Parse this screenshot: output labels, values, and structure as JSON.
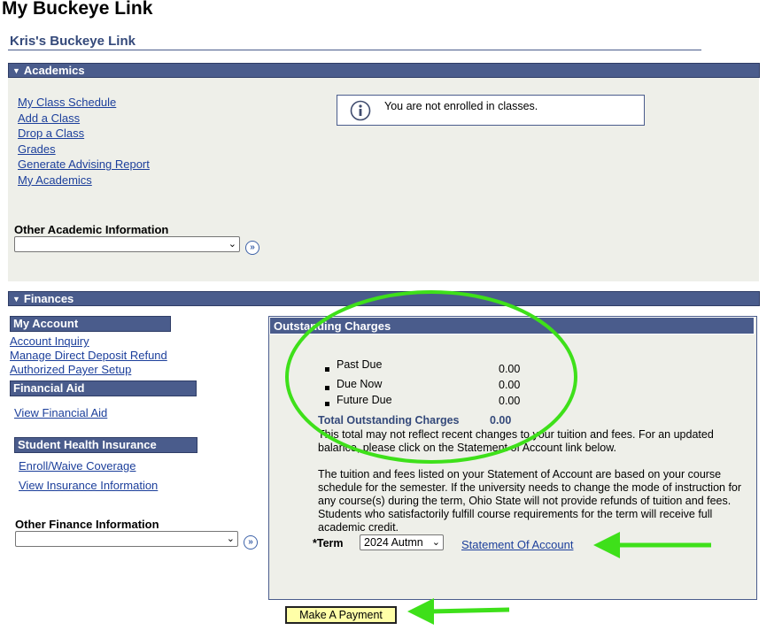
{
  "page_title": "My Buckeye Link",
  "user_header": "Kris's Buckeye Link",
  "academics": {
    "title": "Academics",
    "links": [
      "My Class Schedule",
      "Add a Class",
      "Drop a Class",
      "Grades",
      "Generate Advising Report",
      "My Academics"
    ],
    "notice": "You are not enrolled in classes.",
    "other_label": "Other Academic Information",
    "other_value": ""
  },
  "finances": {
    "title": "Finances",
    "my_account": {
      "title": "My Account",
      "links": [
        "Account Inquiry",
        "Manage Direct Deposit Refund",
        "Authorized Payer Setup"
      ]
    },
    "financial_aid": {
      "title": "Financial Aid",
      "links": [
        "View Financial Aid"
      ]
    },
    "health_insurance": {
      "title": "Student Health Insurance",
      "links": [
        "Enroll/Waive Coverage",
        "View Insurance Information"
      ]
    },
    "other_label": "Other Finance Information",
    "other_value": "",
    "outstanding": {
      "title": "Outstanding Charges",
      "items": [
        {
          "label": "Past Due",
          "amount": "0.00"
        },
        {
          "label": "Due Now",
          "amount": "0.00"
        },
        {
          "label": "Future Due",
          "amount": "0.00"
        }
      ],
      "total_label": "Total Outstanding Charges",
      "total_amount": "0.00",
      "note1": "This total may not reflect recent changes to your tuition and fees. For an updated balance, please click on the Statement of Account link below.",
      "note2": "The tuition and fees listed on your Statement of Account are based on your course schedule for the semester.  If the university needs to change the mode of instruction for any course(s) during the term, Ohio State will not provide refunds of tuition and fees. Students who satisfactorily fulfill course requirements for the term will receive full academic credit.",
      "term_label": "*Term",
      "term_value": "2024 Autmn",
      "statement_link": "Statement Of Account"
    },
    "payment_button": "Make A Payment"
  },
  "colors": {
    "section_bar": "#4a5c8c",
    "section_bg": "#eeefe9",
    "link": "#1c3f9b",
    "annotation": "#3ee01a",
    "button_bg": "#ffffa8"
  }
}
